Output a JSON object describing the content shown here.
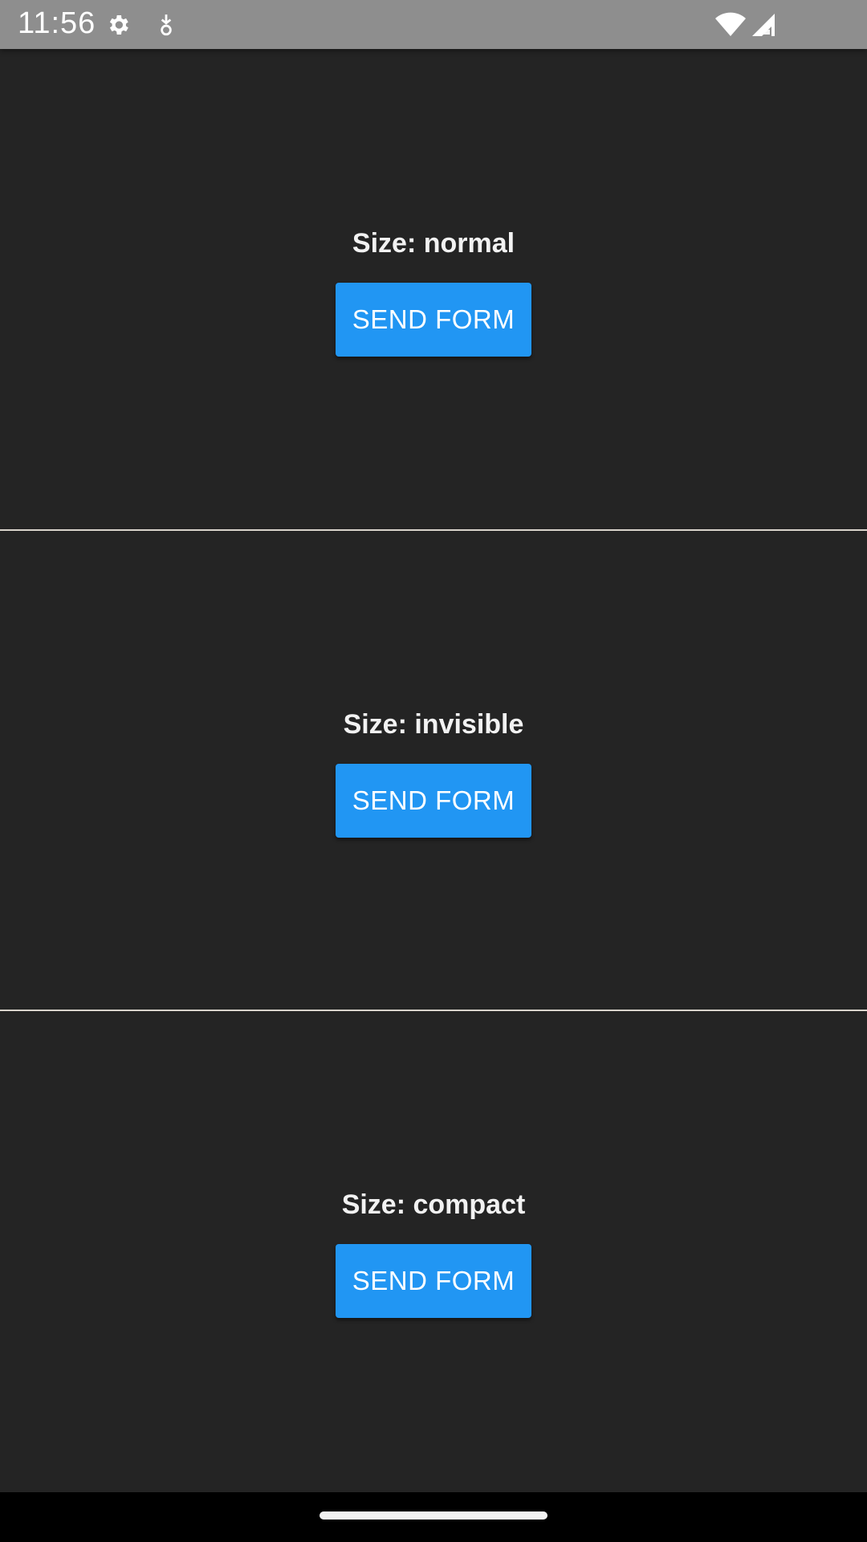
{
  "status_bar": {
    "time": "11:56",
    "icons": [
      "settings-gear-icon",
      "download-indicator-icon",
      "wifi-icon",
      "cellular-signal-icon"
    ]
  },
  "sections": [
    {
      "label": "Size: normal",
      "button_label": "SEND FORM"
    },
    {
      "label": "Size: invisible",
      "button_label": "SEND FORM"
    },
    {
      "label": "Size: compact",
      "button_label": "SEND FORM"
    }
  ],
  "colors": {
    "background": "#242424",
    "button": "#2196f3",
    "divider": "#d9d4cc",
    "status_bar": "#8e8e8e"
  }
}
